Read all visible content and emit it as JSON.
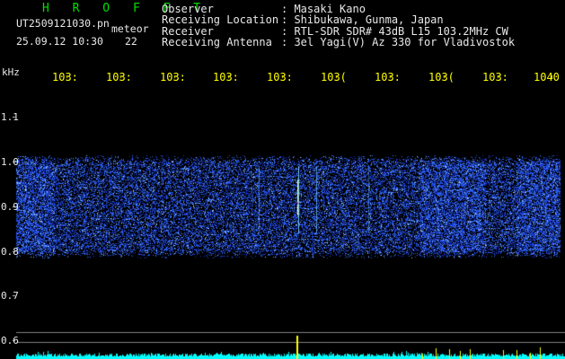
{
  "header": {
    "title": "H R O F F T",
    "filename": "UT2509121030.pn",
    "tag": "meteor",
    "datetime": "25.09.12 10:30",
    "count": "22"
  },
  "info": {
    "rows": [
      {
        "label": "Observer",
        "value": ": Masaki Kano"
      },
      {
        "label": "Receiving Location",
        "value": ": Shibukawa, Gunma, Japan"
      },
      {
        "label": "Receiver",
        "value": ": RTL-SDR SDR# 43dB L15 103.2MHz CW"
      },
      {
        "label": "Receiving Antenna",
        "value": ": 3el Yagi(V) Az 330 for Vladivostok"
      }
    ]
  },
  "axes": {
    "y_unit": "kHz",
    "y_ticks": [
      "1.1",
      "1.0",
      "0.9",
      "0.8",
      "0.7",
      "0.6"
    ],
    "x_ticks": [
      "103:",
      "103:",
      "103:",
      "103:",
      "103:",
      "103(",
      "103:",
      "103(",
      "103:",
      "1040"
    ]
  },
  "colors": {
    "background": "#000000",
    "text": "#e8e8e8",
    "title": "#00e000",
    "time_labels": "#ffff00",
    "signal": "#2040ff",
    "baseline": "#00ffff"
  }
}
